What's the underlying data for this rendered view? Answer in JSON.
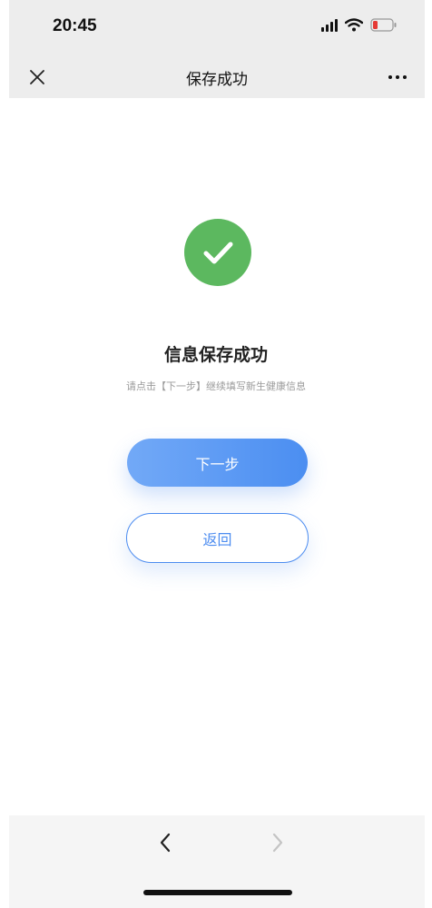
{
  "status_bar": {
    "time": "20:45",
    "battery_color": "#e53935"
  },
  "nav": {
    "close_icon": "close-icon",
    "title": "保存成功",
    "more_icon": "more-icon"
  },
  "content": {
    "status_icon": "checkmark-circle-icon",
    "status_color": "#5cb85f",
    "title": "信息保存成功",
    "subtitle": "请点击【下一步】继续填写新生健康信息"
  },
  "buttons": {
    "next_label": "下一步",
    "back_label": "返回",
    "accent_color": "#4c8cf0"
  },
  "bottom_nav": {
    "back_icon": "chevron-left-icon",
    "forward_icon": "chevron-right-icon"
  }
}
